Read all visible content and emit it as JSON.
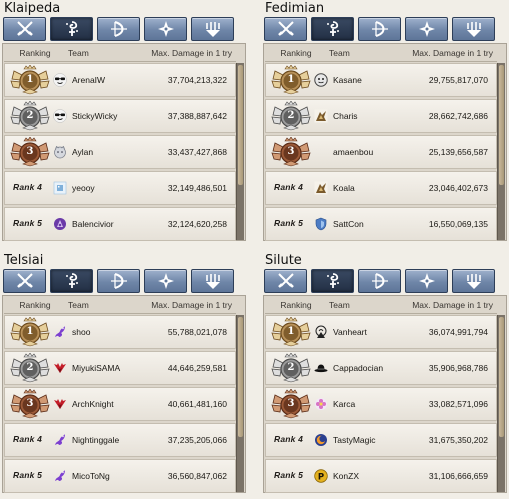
{
  "colors": {
    "tab_active": "#2b3950",
    "tab_inactive": "#7b91b3",
    "gold": "#b9925a",
    "silver": "#9c9c9c",
    "bronze": "#9c5a38"
  },
  "tab_icons": [
    "crossed-swords-icon",
    "swirl-mage-icon",
    "bow-icon",
    "cross-compass-icon",
    "shield-fork-icon"
  ],
  "header": {
    "ranking": "Ranking",
    "team": "Team",
    "damage": "Max. Damage in 1 try"
  },
  "panels": [
    {
      "title": "Klaipeda",
      "active_tab": 1,
      "rows": [
        {
          "rank": "1",
          "rank_text": "",
          "team": "ArenaIW",
          "damage": "37,704,213,322",
          "icon": "sunglasses-emoji-icon"
        },
        {
          "rank": "2",
          "rank_text": "",
          "team": "StickyWicky",
          "damage": "37,388,887,642",
          "icon": "sunglasses-emoji-icon"
        },
        {
          "rank": "3",
          "rank_text": "",
          "team": "Aylan",
          "damage": "33,437,427,868",
          "icon": "cat-face-icon"
        },
        {
          "rank": "",
          "rank_text": "Rank 4",
          "team": "yeooy",
          "damage": "32,149,486,501",
          "icon": "pixel-sprite-icon"
        },
        {
          "rank": "",
          "rank_text": "Rank 5",
          "team": "Balencivior",
          "damage": "32,124,620,258",
          "icon": "purple-emblem-icon"
        }
      ]
    },
    {
      "title": "Fedimian",
      "active_tab": 1,
      "rows": [
        {
          "rank": "1",
          "rank_text": "",
          "team": "Kasane",
          "damage": "29,755,817,070",
          "icon": "round-face-icon"
        },
        {
          "rank": "2",
          "rank_text": "",
          "team": "Charis",
          "damage": "28,662,742,686",
          "icon": "lion-emblem-icon"
        },
        {
          "rank": "3",
          "rank_text": "",
          "team": "amaenbou",
          "damage": "25,139,656,587",
          "icon": "blank-icon"
        },
        {
          "rank": "",
          "rank_text": "Rank 4",
          "team": "Koala",
          "damage": "23,046,402,673",
          "icon": "lion-emblem-icon"
        },
        {
          "rank": "",
          "rank_text": "Rank 5",
          "team": "SattCon",
          "damage": "16,550,069,135",
          "icon": "blue-shield-icon"
        }
      ]
    },
    {
      "title": "Telsiai",
      "active_tab": 1,
      "rows": [
        {
          "rank": "1",
          "rank_text": "",
          "team": "shoo",
          "damage": "55,788,021,078",
          "icon": "purple-dragon-icon"
        },
        {
          "rank": "2",
          "rank_text": "",
          "team": "MiyukiSAMA",
          "damage": "44,646,259,581",
          "icon": "red-wings-icon"
        },
        {
          "rank": "3",
          "rank_text": "",
          "team": "ArchKnight",
          "damage": "40,661,481,160",
          "icon": "red-wings-icon"
        },
        {
          "rank": "",
          "rank_text": "Rank 4",
          "team": "Nightinggale",
          "damage": "37,235,205,066",
          "icon": "purple-dragon-icon"
        },
        {
          "rank": "",
          "rank_text": "Rank 5",
          "team": "MicoToNg",
          "damage": "36,560,847,062",
          "icon": "purple-dragon-icon"
        }
      ]
    },
    {
      "title": "Silute",
      "active_tab": 1,
      "rows": [
        {
          "rank": "1",
          "rank_text": "",
          "team": "Vanheart",
          "damage": "36,074,991,794",
          "icon": "tree-emblem-icon"
        },
        {
          "rank": "2",
          "rank_text": "",
          "team": "Cappadocian",
          "damage": "35,906,968,786",
          "icon": "black-hat-icon"
        },
        {
          "rank": "3",
          "rank_text": "",
          "team": "Karca",
          "damage": "33,082,571,096",
          "icon": "pink-flower-icon"
        },
        {
          "rank": "",
          "rank_text": "Rank 4",
          "team": "TastyMagic",
          "damage": "31,675,350,202",
          "icon": "orange-moon-icon"
        },
        {
          "rank": "",
          "rank_text": "Rank 5",
          "team": "KonZX",
          "damage": "31,106,666,659",
          "icon": "gold-p-coin-icon"
        }
      ]
    }
  ]
}
